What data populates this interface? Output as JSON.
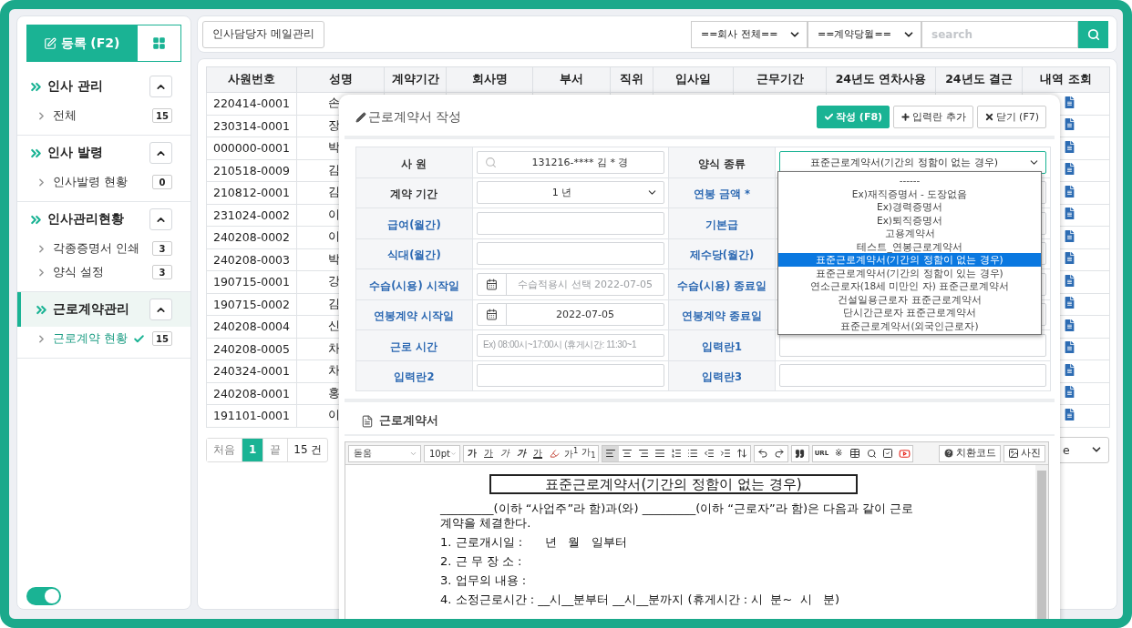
{
  "sidebar": {
    "register_button": "등록 (F2)",
    "groups": [
      {
        "title": "인사 관리",
        "selected": false,
        "expanded": true,
        "items": [
          {
            "label": "전체",
            "count": "15",
            "selected": false
          }
        ]
      },
      {
        "title": "인사 발령",
        "selected": false,
        "expanded": true,
        "items": [
          {
            "label": "인사발령 현황",
            "count": "0",
            "selected": false
          }
        ]
      },
      {
        "title": "인사관리현황",
        "selected": false,
        "expanded": true,
        "items": [
          {
            "label": "각종증명서 인쇄",
            "count": "3",
            "selected": false
          },
          {
            "label": "양식 설정",
            "count": "3",
            "selected": false
          }
        ]
      },
      {
        "title": "근로계약관리",
        "selected": true,
        "expanded": true,
        "items": [
          {
            "label": "근로계약 현황",
            "count": "15",
            "selected": true
          }
        ]
      }
    ],
    "toggle": {
      "on": true
    }
  },
  "toolbar": {
    "mail_button": "인사담당자 메일관리",
    "company_select": "==회사 전체==",
    "month_select": "==계약당월==",
    "search": {
      "placeholder": "search"
    }
  },
  "table": {
    "columns": [
      "사원번호",
      "성명",
      "계약기간",
      "회사명",
      "부서",
      "직위",
      "입사일",
      "근무기간",
      "24년도 연차사용",
      "24년도 결근",
      "내역 조회"
    ],
    "rows": [
      {
        "employee_no": "220414-0001",
        "name": "손"
      },
      {
        "employee_no": "230314-0001",
        "name": "장"
      },
      {
        "employee_no": "000000-0001",
        "name": "박"
      },
      {
        "employee_no": "210518-0009",
        "name": "김"
      },
      {
        "employee_no": "210812-0001",
        "name": "김"
      },
      {
        "employee_no": "231024-0002",
        "name": "이"
      },
      {
        "employee_no": "240208-0002",
        "name": "이"
      },
      {
        "employee_no": "240208-0003",
        "name": "박"
      },
      {
        "employee_no": "190715-0001",
        "name": "강"
      },
      {
        "employee_no": "190715-0002",
        "name": "김"
      },
      {
        "employee_no": "240208-0004",
        "name": "신"
      },
      {
        "employee_no": "240208-0005",
        "name": "차"
      },
      {
        "employee_no": "240324-0001",
        "name": "차"
      },
      {
        "employee_no": "240208-0001",
        "name": "홍"
      },
      {
        "employee_no": "191101-0001",
        "name": "이"
      }
    ]
  },
  "pagination": {
    "first": "처음",
    "pages": [
      {
        "label": "1",
        "selected": true
      }
    ],
    "last": "끝",
    "total": "15 건",
    "page_size": "e"
  },
  "modal": {
    "title": "근로계약서 작성",
    "buttons": [
      {
        "label": "작성 (F8)",
        "kind": "primary"
      },
      {
        "label": "입력란 추가",
        "kind": "add"
      },
      {
        "label": "닫기 (F7)",
        "kind": "close"
      }
    ],
    "form": [
      {
        "cells": [
          {
            "label": "사 원",
            "color": "#333333",
            "field": {
              "kind": "search",
              "value": "131216-**** 김 * 경"
            }
          },
          {
            "label": "양식 종류",
            "color": "#333333",
            "field": {
              "kind": "select",
              "value": "표준근로계약서(기간의 정함이 없는 경우)"
            }
          }
        ]
      },
      {
        "cells": [
          {
            "label": "계약 기간",
            "color": "#333333",
            "field": {
              "kind": "select",
              "value": "1 년"
            }
          },
          {
            "label": "연봉 금액 *",
            "color": "#2a67b1",
            "field": {
              "kind": "text"
            }
          }
        ]
      },
      {
        "cells": [
          {
            "label": "급여(월간)",
            "color": "#2a67b1",
            "field": {
              "kind": "text"
            }
          },
          {
            "label": "기본급",
            "color": "#2a67b1",
            "field": {
              "kind": "text"
            }
          }
        ]
      },
      {
        "cells": [
          {
            "label": "식대(월간)",
            "color": "#2a67b1",
            "field": {
              "kind": "text"
            }
          },
          {
            "label": "제수당(월간)",
            "color": "#2a67b1",
            "field": {
              "kind": "text"
            }
          }
        ]
      },
      {
        "cells": [
          {
            "label": "수습(시용) 시작일",
            "color": "#2a67b1",
            "field": {
              "kind": "date",
              "placeholder": "수습적용시 선택 2022-07-05"
            }
          },
          {
            "label": "수습(시용) 종료일",
            "color": "#2a67b1",
            "field": {
              "kind": "text"
            }
          }
        ]
      },
      {
        "cells": [
          {
            "label": "연봉계약 시작일",
            "color": "#2a67b1",
            "field": {
              "kind": "date",
              "value": "2022-07-05"
            }
          },
          {
            "label": "연봉계약 종료일",
            "color": "#2a67b1",
            "field": {
              "kind": "text"
            }
          }
        ]
      },
      {
        "cells": [
          {
            "label": "근로 시간",
            "color": "#2a67b1",
            "field": {
              "kind": "text",
              "placeholder": "Ex) 08:00시~17:00시 (휴게시간: 11:30~1"
            }
          },
          {
            "label": "입력란1",
            "color": "#2a67b1",
            "field": {
              "kind": "text"
            }
          }
        ]
      },
      {
        "cells": [
          {
            "label": "입력란2",
            "color": "#2a67b1",
            "field": {
              "kind": "text"
            }
          },
          {
            "label": "입력란3",
            "color": "#2a67b1",
            "field": {
              "kind": "text"
            }
          }
        ]
      }
    ],
    "template_dropdown": {
      "options": [
        {
          "label": "------",
          "selected": false
        },
        {
          "label": "Ex)재직증명서 - 도장없음",
          "selected": false
        },
        {
          "label": "Ex)경력증명서",
          "selected": false
        },
        {
          "label": "Ex)퇴직증명서",
          "selected": false
        },
        {
          "label": "고용계약서",
          "selected": false
        },
        {
          "label": "테스트_연봉근로계약서",
          "selected": false
        },
        {
          "label": "표준근로계약서(기간의 정함이 없는 경우)",
          "selected": true
        },
        {
          "label": "표준근로계약서(기간의 정함이 있는 경우)",
          "selected": false
        },
        {
          "label": "연소근로자(18세 미만인 자) 표준근로계약서",
          "selected": false
        },
        {
          "label": "건설일용근로자 표준근로계약서",
          "selected": false
        },
        {
          "label": "단시간근로자 표준근로계약서",
          "selected": false
        },
        {
          "label": "표준근로계약서(외국인근로자)",
          "selected": false
        }
      ]
    },
    "section_title": "근로계약서",
    "editor": {
      "font": "돋움",
      "size": "10pt",
      "format_buttons": [
        {
          "kind": "bold",
          "label": "가"
        },
        {
          "kind": "underline",
          "label": "가"
        },
        {
          "kind": "italic",
          "label": "가"
        },
        {
          "kind": "strike",
          "label": "가"
        },
        {
          "kind": "color",
          "label": "가"
        },
        {
          "kind": "highlight"
        },
        {
          "kind": "sup",
          "label": "가$^{1}$"
        },
        {
          "kind": "sub",
          "label": "가$_{1}$"
        }
      ],
      "align_buttons": [
        {
          "kind": "left",
          "selected": true
        },
        {
          "kind": "center",
          "selected": false
        },
        {
          "kind": "right",
          "selected": false
        },
        {
          "kind": "justify",
          "selected": false
        }
      ],
      "url_label": "URL",
      "symbol_label": "※",
      "code_button": "치환코드",
      "photo_button": "사진",
      "document": {
        "title": "표준근로계약서(기간의 정함이 없는 경우)",
        "paragraphs": [
          "_________(이하 “사업주”라 함)과(와) _________(이하 “근로자”라 함)은 다음과 같이 근로계약을 체결한다.",
          "1. 근로개시일 :      년   월   일부터",
          "2. 근 무 장 소 :",
          "3. 업무의 내용 :",
          "4. 소정근로시간 : __시__분부터 __시__분까지 (휴게시간 : 시  분~  시   분)"
        ]
      }
    }
  }
}
